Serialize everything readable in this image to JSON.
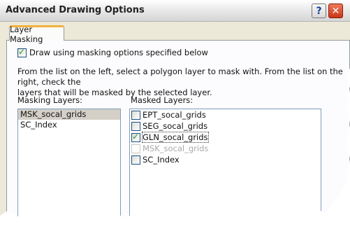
{
  "window": {
    "title": "Advanced Drawing Options"
  },
  "titlebar": {
    "help_label": "?",
    "close_label": "✕"
  },
  "tabs": [
    {
      "label": "Layer Masking"
    }
  ],
  "options": {
    "draw_masking_label": "Draw using masking options specified below",
    "draw_masking_checked": true
  },
  "description": "From the list on the left, select a polygon layer to mask with. From the list on the right, check the\nlayers that will be masked by the selected layer.",
  "masking_layers": {
    "label": "Masking Layers:",
    "items": [
      {
        "label": "MSK_socal_grids",
        "selected": true
      },
      {
        "label": "SC_Index",
        "selected": false
      }
    ]
  },
  "masked_layers": {
    "label": "Masked Layers:",
    "items": [
      {
        "label": "EPT_socal_grids",
        "checked": false,
        "disabled": false
      },
      {
        "label": "SEG_socal_grids",
        "checked": false,
        "disabled": false
      },
      {
        "label": "GLN_socal_grids",
        "checked": true,
        "disabled": false
      },
      {
        "label": "MSK_socal_grids",
        "checked": false,
        "disabled": true
      },
      {
        "label": "SC_Index",
        "checked": false,
        "disabled": false
      }
    ]
  }
}
